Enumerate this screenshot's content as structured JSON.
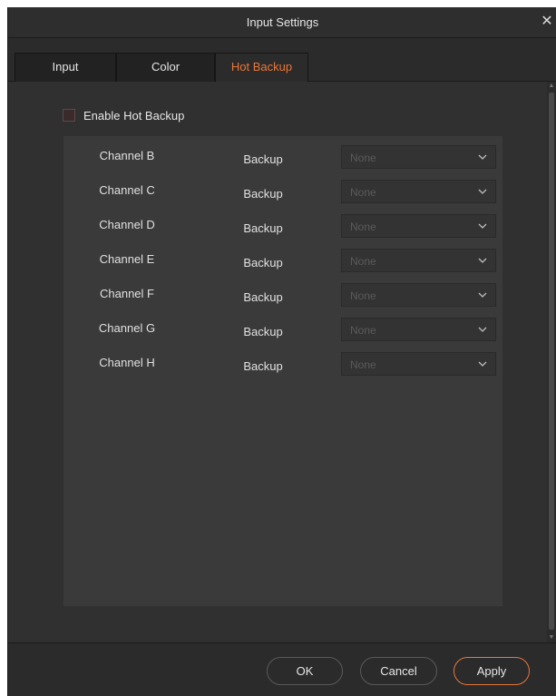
{
  "window": {
    "title": "Input Settings",
    "close_glyph": "✕",
    "close_icon": "close-icon"
  },
  "tabs": [
    {
      "label": "Input",
      "active": false
    },
    {
      "label": "Color",
      "active": false
    },
    {
      "label": "Hot Backup",
      "active": true
    }
  ],
  "hot_backup": {
    "enable_label": "Enable Hot Backup",
    "enabled": false,
    "channels": [
      {
        "name": "Channel B",
        "backup_label": "Backup",
        "selected": "None"
      },
      {
        "name": "Channel C",
        "backup_label": "Backup",
        "selected": "None"
      },
      {
        "name": "Channel D",
        "backup_label": "Backup",
        "selected": "None"
      },
      {
        "name": "Channel E",
        "backup_label": "Backup",
        "selected": "None"
      },
      {
        "name": "Channel F",
        "backup_label": "Backup",
        "selected": "None"
      },
      {
        "name": "Channel G",
        "backup_label": "Backup",
        "selected": "None"
      },
      {
        "name": "Channel H",
        "backup_label": "Backup",
        "selected": "None"
      }
    ]
  },
  "footer": {
    "ok_label": "OK",
    "cancel_label": "Cancel",
    "apply_label": "Apply"
  },
  "colors": {
    "accent": "#e8763a",
    "background": "#2b2b2b",
    "panel": "#3a3a3a"
  }
}
